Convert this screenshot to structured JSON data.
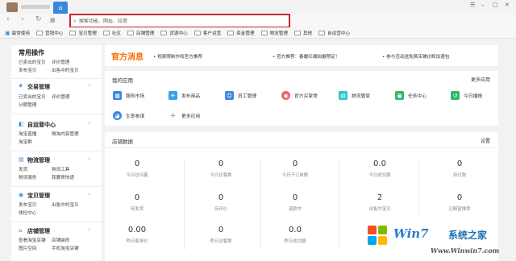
{
  "browser": {
    "home_icon": "home-icon",
    "window_controls": [
      "☰",
      "–",
      "□",
      "✕"
    ],
    "nav": {
      "back": "‹",
      "forward": "›",
      "refresh": "↻",
      "grid": "▦"
    },
    "search": {
      "placeholder": "搜索功能、网址、应用",
      "icon": "search-icon"
    },
    "right_icons": [
      "circle-icon",
      "mail-icon",
      "grid-icon",
      "info-icon"
    ]
  },
  "bookmarks": [
    {
      "label": "最常使用",
      "type": "star"
    },
    {
      "label": "营销中心",
      "type": "folder"
    },
    {
      "label": "宝贝管理",
      "type": "folder"
    },
    {
      "label": "社区",
      "type": "folder"
    },
    {
      "label": "店铺管理",
      "type": "folder"
    },
    {
      "label": "货源中心",
      "type": "folder"
    },
    {
      "label": "客户运营",
      "type": "folder"
    },
    {
      "label": "资金管理",
      "type": "folder"
    },
    {
      "label": "物流管理",
      "type": "folder"
    },
    {
      "label": "其他",
      "type": "folder"
    },
    {
      "label": "自运营中心",
      "type": "folder"
    }
  ],
  "sidebar": {
    "groups": [
      {
        "title": "常用操作",
        "icon": "",
        "links": [
          [
            "已卖出的宝贝",
            "评价管理"
          ],
          [
            "发布宝贝",
            "出售中的宝贝"
          ]
        ]
      },
      {
        "title": "交易管理",
        "icon": "transaction-icon",
        "links": [
          [
            "已卖出的宝贝",
            "评价管理"
          ],
          [
            "分期管理",
            ""
          ]
        ]
      },
      {
        "title": "自运营中心",
        "icon": "operation-icon",
        "links": [
          [
            "淘宝直播",
            "微淘内容管理"
          ],
          [
            "淘宝群",
            ""
          ]
        ]
      },
      {
        "title": "物流管理",
        "icon": "logistics-icon",
        "links": [
          [
            "发货",
            "物流工具"
          ],
          [
            "物流服务",
            "我要寄快递"
          ]
        ]
      },
      {
        "title": "宝贝管理",
        "icon": "product-icon",
        "links": [
          [
            "发布宝贝",
            "出售中的宝贝"
          ],
          [
            "体检中心",
            ""
          ]
        ]
      },
      {
        "title": "店铺管理",
        "icon": "store-icon",
        "links": [
          [
            "查看淘宝店铺",
            "店铺装修"
          ],
          [
            "图片空间",
            "手机淘宝店铺"
          ]
        ]
      }
    ]
  },
  "promo": {
    "title": "官方消息",
    "items": [
      "视频照制作和官方推荐",
      "官方推荐：春暖红缓拍摄预定！",
      "参与活动送免费店铺诊断加速包"
    ]
  },
  "apps": {
    "title": "我的应用",
    "more": "更多应用",
    "items": [
      {
        "label": "服务市场",
        "icon": "service-market-icon",
        "color": "#3b87e0",
        "glyph": "▦"
      },
      {
        "label": "发布商品",
        "icon": "publish-icon",
        "color": "#3ba0e8",
        "glyph": "✈"
      },
      {
        "label": "员工管理",
        "icon": "staff-icon",
        "color": "#3b87e0",
        "glyph": "☺"
      },
      {
        "label": "官方买家秀",
        "icon": "buyer-show-icon",
        "color": "#f06060",
        "glyph": "◉"
      },
      {
        "label": "物流管家",
        "icon": "logistics-icon",
        "color": "#2ec4c4",
        "glyph": "▤"
      },
      {
        "label": "任务中心",
        "icon": "task-icon",
        "color": "#2eb86a",
        "glyph": "▣"
      },
      {
        "label": "今日播报",
        "icon": "broadcast-icon",
        "color": "#2eb86a",
        "glyph": "↺"
      },
      {
        "label": "生意参谋",
        "icon": "advisor-icon",
        "color": "#3b87e0",
        "glyph": "◕"
      },
      {
        "label": "更多应用",
        "icon": "add-icon",
        "color": "#ffffff",
        "glyph": "+"
      }
    ]
  },
  "store": {
    "title": "店铺数据",
    "settings": "设置",
    "rows": [
      [
        {
          "value": "0",
          "label": "今日访问量"
        },
        {
          "value": "0",
          "label": "今日访客数"
        },
        {
          "value": "0",
          "label": "今日子订单数"
        },
        {
          "value": "0.0",
          "label": "今日成交额"
        },
        {
          "value": "0",
          "label": "待付款"
        }
      ],
      [
        {
          "value": "0",
          "label": "待发货"
        },
        {
          "value": "0",
          "label": "待评价"
        },
        {
          "value": "0",
          "label": "退款中"
        },
        {
          "value": "2",
          "label": "出售中宝贝"
        },
        {
          "value": "0",
          "label": "已橱窗推荐"
        }
      ],
      [
        {
          "value": "0.00",
          "label": "昨日客单价"
        },
        {
          "value": "0",
          "label": "昨日访客数"
        },
        {
          "value": "0.0",
          "label": "昨日成交额"
        }
      ]
    ]
  },
  "watermark": {
    "brand": "Win7",
    "cn": "系统之家",
    "url": "Www.Winwin7.com"
  }
}
